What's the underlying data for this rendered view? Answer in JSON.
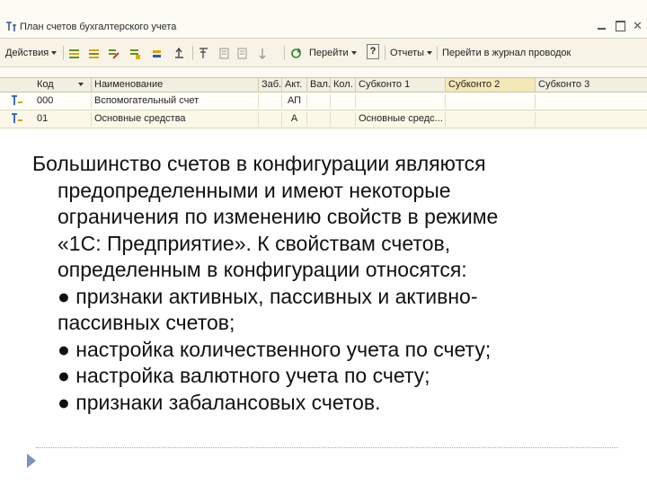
{
  "window": {
    "title": "План счетов бухгалтерского учета",
    "icon": "accounts-plan-icon"
  },
  "toolbar": {
    "actions_label": "Действия",
    "goto_label": "Перейти",
    "help_label": "?",
    "reports_label": "Отчеты",
    "journal_label": "Перейти в журнал проводок"
  },
  "table": {
    "columns": [
      "Код",
      "Наименование",
      "Заб.",
      "Акт.",
      "Вал.",
      "Кол.",
      "Субконто 1",
      "Субконто 2",
      "Субконто 3"
    ],
    "rows": [
      {
        "code": "000",
        "name": "Вспомогательный счет",
        "zab": "",
        "akt": "АП",
        "val": "",
        "kol": "",
        "sub1": "",
        "sub2": "",
        "sub3": ""
      },
      {
        "code": "01",
        "name": "Основные средства",
        "zab": "",
        "akt": "А",
        "val": "",
        "kol": "",
        "sub1": "Основные средс...",
        "sub2": "",
        "sub3": ""
      }
    ]
  },
  "slide": {
    "line1": "Большинство счетов в конфигурации являются",
    "line2": "предопределенными и имеют некоторые",
    "line3": "ограничения по изменению свойств в режиме",
    "line4": "«1С: Предприятие». К свойствам счетов,",
    "line5": "определенным в конфигурации относятся:",
    "bullet1_a": "● признаки активных, пассивных и активно-",
    "bullet1_b": "пассивных счетов;",
    "bullet2": "● настройка количественного учета по счету;",
    "bullet3": "● настройка валютного учета по счету;",
    "bullet4": "● признаки забалансовых счетов."
  },
  "colors": {
    "header_selected": "#f4e8b7",
    "footer_arrow": "#7d93b8"
  }
}
